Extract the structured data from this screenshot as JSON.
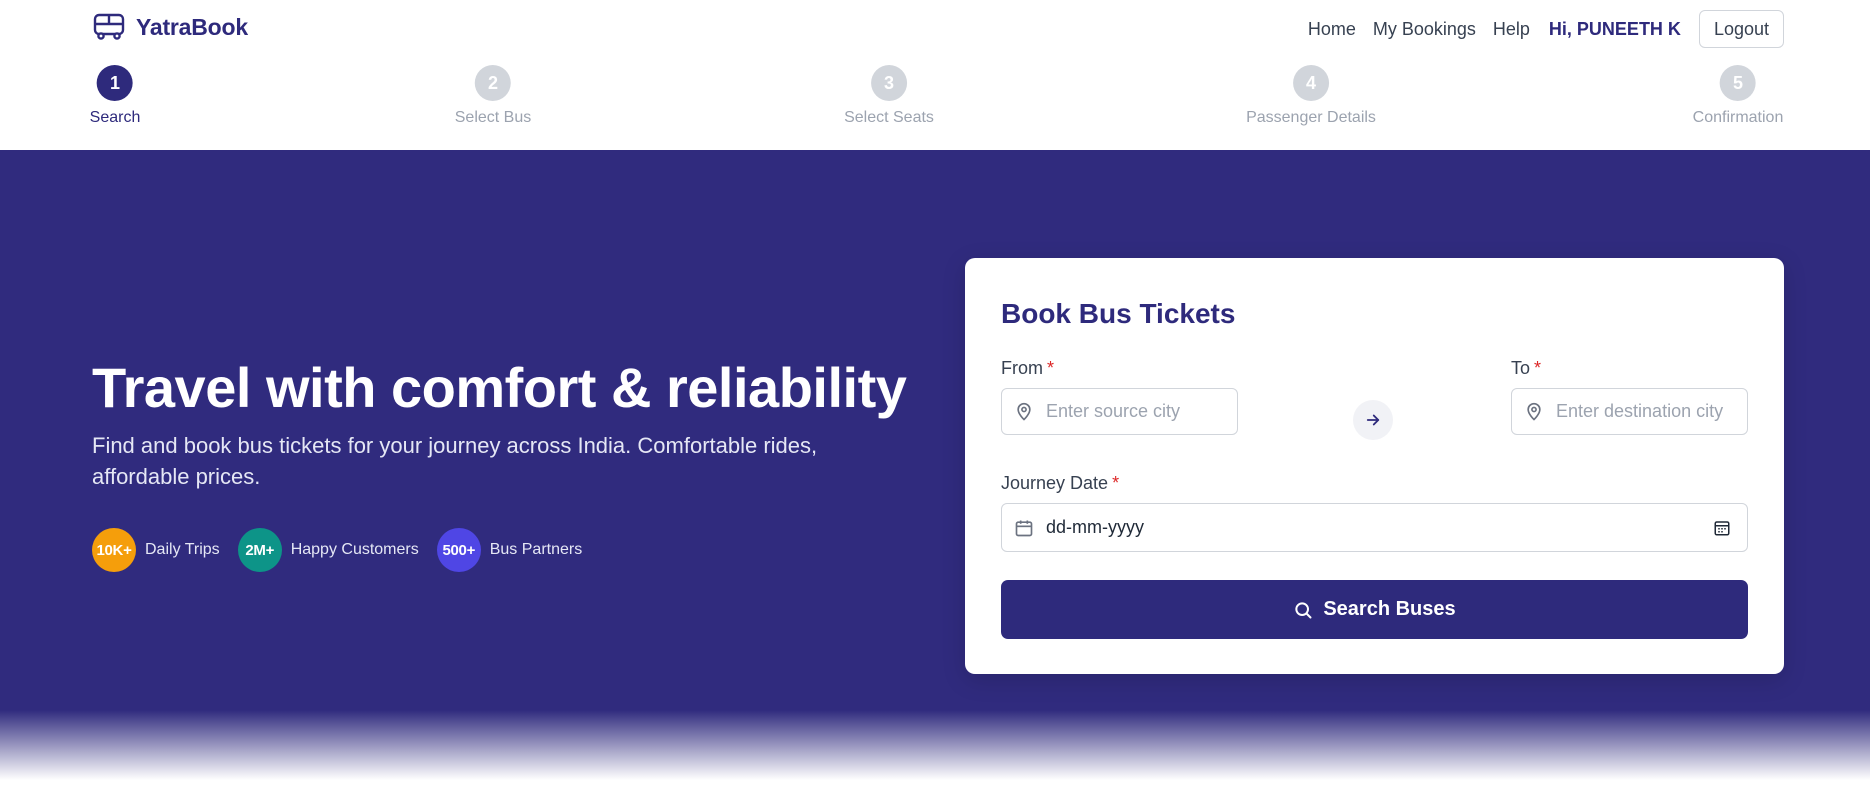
{
  "brand": {
    "name": "YatraBook",
    "icon": "bus-icon"
  },
  "nav": {
    "links": [
      "Home",
      "My Bookings",
      "Help"
    ],
    "greeting": "Hi, PUNEETH K",
    "logout_label": "Logout"
  },
  "stepper": {
    "active_step": 1,
    "steps": [
      {
        "number": "1",
        "label": "Search"
      },
      {
        "number": "2",
        "label": "Select Bus"
      },
      {
        "number": "3",
        "label": "Select Seats"
      },
      {
        "number": "4",
        "label": "Passenger Details"
      },
      {
        "number": "5",
        "label": "Confirmation"
      }
    ]
  },
  "hero": {
    "title": "Travel with comfort & reliability",
    "subtitle": "Find and book bus tickets for your journey across India. Comfortable rides, affordable prices.",
    "stats": [
      {
        "value": "10K+",
        "label": "Daily Trips",
        "color": "#f59e0b"
      },
      {
        "value": "2M+",
        "label": "Happy Customers",
        "color": "#0d9488"
      },
      {
        "value": "500+",
        "label": "Bus Partners",
        "color": "#4f46e5"
      }
    ]
  },
  "booking": {
    "title": "Book Bus Tickets",
    "from": {
      "label": "From",
      "required_mark": "*",
      "placeholder": "Enter source city",
      "value": ""
    },
    "to": {
      "label": "To",
      "required_mark": "*",
      "placeholder": "Enter destination city",
      "value": ""
    },
    "date": {
      "label": "Journey Date",
      "required_mark": "*",
      "value": "dd-mm-yyyy"
    },
    "search_label": "Search Buses"
  },
  "colors": {
    "primary": "#2e2a7c",
    "hero_bg": "#302b7e",
    "required": "#dc2626"
  }
}
